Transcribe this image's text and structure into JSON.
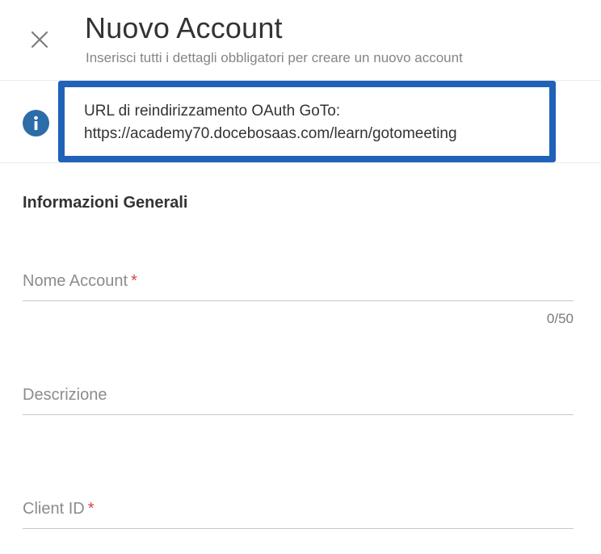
{
  "header": {
    "title": "Nuovo Account",
    "subtitle": "Inserisci tutti i dettagli obbligatori per creare un nuovo account",
    "close_icon": "close-icon"
  },
  "info": {
    "icon": "info-icon",
    "line1": "URL di reindirizzamento OAuth GoTo:",
    "line2": "https://academy70.docebosaas.com/learn/gotomeeting",
    "highlight_color": "#1f62b7",
    "icon_color": "#2c6ca8"
  },
  "form": {
    "section_title": "Informazioni Generali",
    "required_marker": "*",
    "required_color": "#d64545",
    "fields": {
      "account_name": {
        "label": "Nome Account",
        "value": "",
        "counter": "0/50"
      },
      "description": {
        "label": "Descrizione",
        "value": ""
      },
      "client_id": {
        "label": "Client ID",
        "value": ""
      }
    }
  }
}
